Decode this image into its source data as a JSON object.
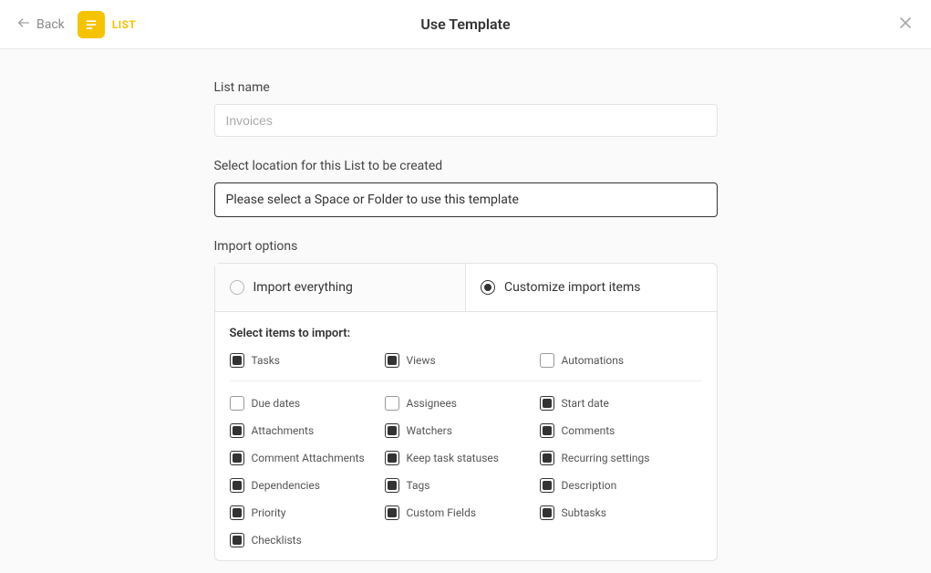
{
  "header": {
    "back_label": "Back",
    "type_label": "LIST",
    "title": "Use Template"
  },
  "form": {
    "list_name_label": "List name",
    "list_name_placeholder": "Invoices",
    "location_label": "Select location for this List to be created",
    "location_placeholder": "Please select a Space or Folder to use this template",
    "import_options_label": "Import options",
    "radio_everything": "Import everything",
    "radio_customize": "Customize import items",
    "select_items_label": "Select items to import:",
    "top_items": [
      {
        "label": "Tasks",
        "checked": true
      },
      {
        "label": "Views",
        "checked": true
      },
      {
        "label": "Automations",
        "checked": false
      }
    ],
    "grid_items": [
      {
        "label": "Due dates",
        "checked": false
      },
      {
        "label": "Assignees",
        "checked": false
      },
      {
        "label": "Start date",
        "checked": true
      },
      {
        "label": "Attachments",
        "checked": true
      },
      {
        "label": "Watchers",
        "checked": true
      },
      {
        "label": "Comments",
        "checked": true
      },
      {
        "label": "Comment Attachments",
        "checked": true
      },
      {
        "label": "Keep task statuses",
        "checked": true
      },
      {
        "label": "Recurring settings",
        "checked": true
      },
      {
        "label": "Dependencies",
        "checked": true
      },
      {
        "label": "Tags",
        "checked": true
      },
      {
        "label": "Description",
        "checked": true
      },
      {
        "label": "Priority",
        "checked": true
      },
      {
        "label": "Custom Fields",
        "checked": true
      },
      {
        "label": "Subtasks",
        "checked": true
      },
      {
        "label": "Checklists",
        "checked": true
      }
    ]
  }
}
